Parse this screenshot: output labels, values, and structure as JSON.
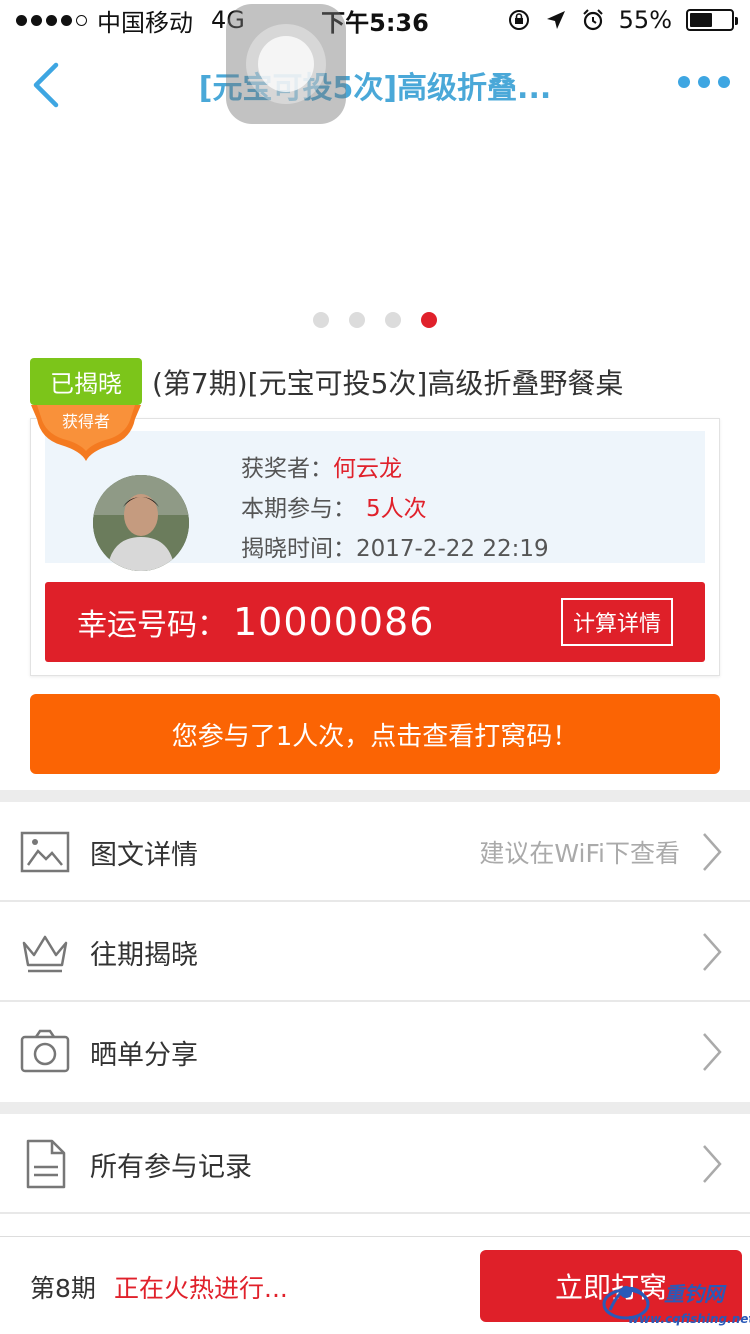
{
  "status_bar": {
    "carrier": "中国移动",
    "network": "4G",
    "time": "下午5:36",
    "battery_percent": "55%",
    "battery_level": 0.55
  },
  "nav": {
    "title": "[元宝可投5次]高级折叠...",
    "back_icon": "chevron-left-icon",
    "more_icon": "more-dots-icon"
  },
  "carousel": {
    "dot_count": 4,
    "active_index": 3
  },
  "product": {
    "status_badge": "已揭晓",
    "title": "(第7期)[元宝可投5次]高级折叠野餐桌"
  },
  "winner": {
    "ribbon_label": "获得者",
    "winner_label": "获奖者：",
    "winner_name": "何云龙",
    "participation_label": "本期参与：",
    "participation_value": "5人次",
    "reveal_time_label": "揭晓时间：",
    "reveal_time_value": "2017-2-22 22:19",
    "lucky_label": "幸运号码：",
    "lucky_number": "10000086",
    "calc_button": "计算详情"
  },
  "participation_button": "您参与了1人次，点击查看打窝码！",
  "list": {
    "details": {
      "label": "图文详情",
      "hint": "建议在WiFi下查看",
      "icon": "image-icon"
    },
    "history": {
      "label": "往期揭晓",
      "icon": "crown-icon"
    },
    "share": {
      "label": "晒单分享",
      "icon": "camera-icon"
    },
    "records": {
      "label": "所有参与记录",
      "icon": "document-icon"
    }
  },
  "bottom": {
    "period": "第8期",
    "status": "正在火热进行...",
    "join_button": "立即打窝"
  },
  "watermark": {
    "text": "重钓网",
    "url": "www.cqfishing.net"
  },
  "colors": {
    "accent_blue": "#4aa8d8",
    "red": "#df2029",
    "orange": "#fb6404",
    "green_badge": "#7cc51a"
  }
}
